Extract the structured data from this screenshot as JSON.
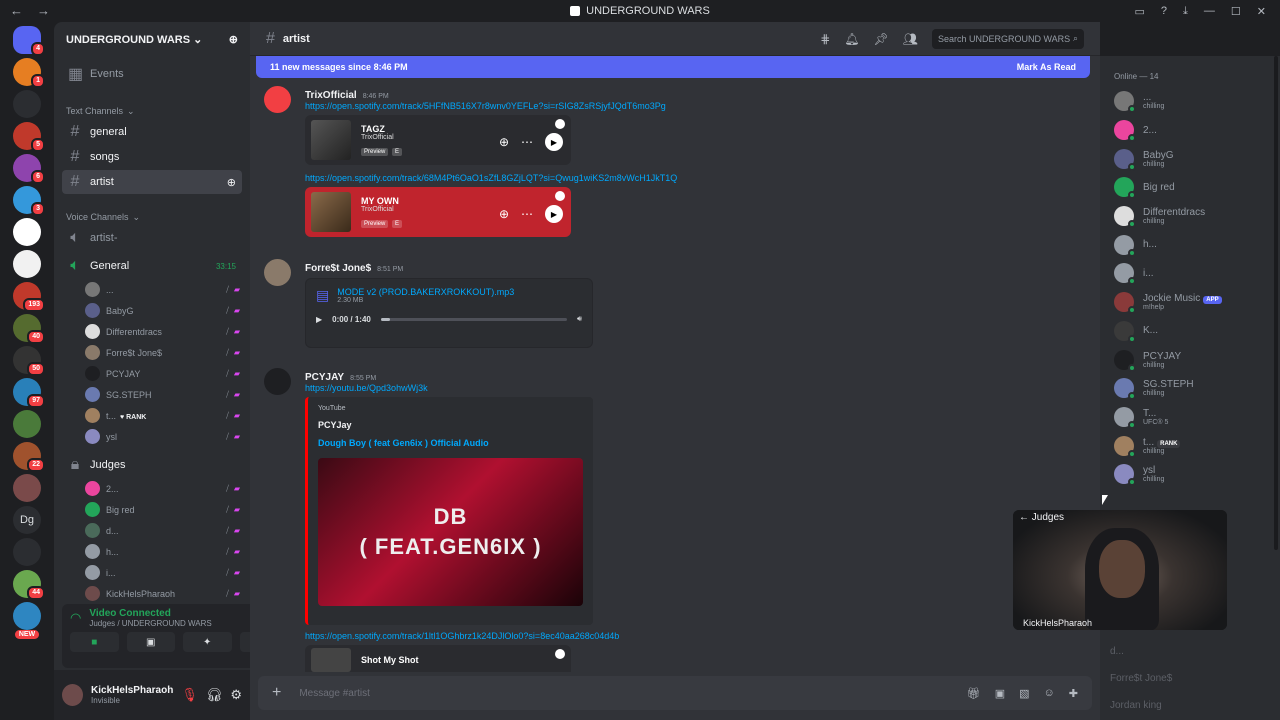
{
  "window": {
    "title": "UNDERGROUND WARS"
  },
  "servers": [
    {
      "color": "#5865f2",
      "badge": "4"
    },
    {
      "color": "#e67e22",
      "badge": "1"
    },
    {
      "color": "#2b2d31",
      "badge": ""
    },
    {
      "color": "#c0392b",
      "badge": "5"
    },
    {
      "color": "#8e44ad",
      "badge": "6"
    },
    {
      "color": "#3498db",
      "badge": "3"
    },
    {
      "color": "#ffffff",
      "badge": ""
    },
    {
      "color": "#f1f1f1",
      "badge": ""
    },
    {
      "color": "#c0392b",
      "badge": "193"
    },
    {
      "color": "#556b2f",
      "badge": "40"
    },
    {
      "color": "#333333",
      "badge": "50"
    },
    {
      "color": "#2980b9",
      "badge": "97"
    },
    {
      "color": "#4a7a3a",
      "badge": ""
    },
    {
      "color": "#a0522d",
      "badge": "22"
    },
    {
      "color": "#7a4a4a",
      "badge": ""
    },
    {
      "color": "#2b2d31",
      "badge": ""
    },
    {
      "color": "#6aa84f",
      "badge": "44"
    },
    {
      "color": "#2e86c1",
      "badge": ""
    }
  ],
  "server_dg_label": "Dg",
  "server_new_label": "NEW",
  "sidebar": {
    "server_name": "UNDERGROUND WARS",
    "events": "Events",
    "text_category": "Text Channels",
    "text_channels": [
      "general",
      "songs",
      "artist"
    ],
    "voice_category": "Voice Channels",
    "voice_channels": [
      {
        "name": "artist-",
        "time": ""
      },
      {
        "name": "General",
        "time": "33:15"
      }
    ],
    "general_users": [
      {
        "name": "...",
        "color": "#777"
      },
      {
        "name": "BabyG",
        "color": "#5a5f8a"
      },
      {
        "name": "Differentdracs",
        "color": "#ddd"
      },
      {
        "name": "Forre$t Jone$",
        "color": "#8a7a6a"
      },
      {
        "name": "PCYJAY",
        "color": "#1e1f22"
      },
      {
        "name": "SG.STEPH",
        "color": "#6a7ab0"
      },
      {
        "name": "t...",
        "color": "#a08060"
      },
      {
        "name": "ysl",
        "color": "#8a8ac0"
      }
    ],
    "rank_label": "RANK",
    "judges_channel": "Judges",
    "judges_users": [
      {
        "name": "2...",
        "color": "#eb459e"
      },
      {
        "name": "Big red",
        "color": "#23a55a"
      },
      {
        "name": "d...",
        "color": "#4a6a5a"
      },
      {
        "name": "h...",
        "color": "#949ba4"
      },
      {
        "name": "i...",
        "color": "#949ba4"
      },
      {
        "name": "KickHelsPharaoh",
        "color": "#6d4b4b"
      }
    ]
  },
  "voice_panel": {
    "title": "Video Connected",
    "subtitle": "Judges / UNDERGROUND WARS"
  },
  "user_panel": {
    "name": "KickHelsPharaoh",
    "status": "Invisible"
  },
  "channel": {
    "name": "artist",
    "search_placeholder": "Search UNDERGROUND WARS",
    "new_messages": "11 new messages since 8:46 PM",
    "mark_read": "Mark As Read",
    "composer_placeholder": "Message #artist"
  },
  "messages": {
    "m1": {
      "author": "TrixOfficial",
      "time": "8:46 PM",
      "link1": "https://open.spotify.com/track/5HFfNB516X7r8wnv0YEFLe?si=rSIG8ZsRSjyfJQdT6mo3Pg",
      "card1": {
        "title": "TAGZ",
        "artist": "TrixOfficial",
        "preview": "Preview",
        "explicit": "E"
      },
      "link2": "https://open.spotify.com/track/68M4Pt6OaO1sZfL8GZjLQT?si=Qwug1wiKS2m8vWcH1JkT1Q",
      "card2": {
        "title": "MY OWN",
        "artist": "TrixOfficial",
        "preview": "Preview",
        "explicit": "E"
      }
    },
    "m2": {
      "author": "Forre$t Jone$",
      "time": "8:51 PM",
      "file": "MODE v2 (PROD.BAKERXROKKOUT).mp3",
      "size": "2.30 MB",
      "progress": "0:00 / 1:40"
    },
    "m3": {
      "author": "PCYJAY",
      "time": "8:55 PM",
      "link": "https://youtu.be/Qpd3ohwWj3k",
      "provider": "YouTube",
      "channel": "PCYJay",
      "video_title": "Dough Boy ( feat Gen6ix ) Official Audio",
      "thumb_text": "DB\n( FEAT.GEN6IX )",
      "link2": "https://open.spotify.com/track/1ltl1OGhbrz1k24DJlOlo0?si=8ec40aa268c04d4b",
      "card3": {
        "title": "Shot My Shot"
      }
    }
  },
  "members": {
    "header": "Online — 14",
    "list": [
      {
        "name": "...",
        "status": "chilling",
        "color": "#777"
      },
      {
        "name": "2...",
        "status": "",
        "color": "#eb459e"
      },
      {
        "name": "BabyG",
        "status": "chilling",
        "color": "#5a5f8a"
      },
      {
        "name": "Big red",
        "status": "",
        "color": "#23a55a"
      },
      {
        "name": "Differentdracs",
        "status": "chilling",
        "color": "#ddd"
      },
      {
        "name": "h...",
        "status": "",
        "color": "#949ba4"
      },
      {
        "name": "i...",
        "status": "",
        "color": "#949ba4"
      },
      {
        "name": "Jockie Music",
        "status": "m!help",
        "color": "#8a3a3a",
        "tag": "APP"
      },
      {
        "name": "K...",
        "status": "",
        "color": "#3a3a3a"
      },
      {
        "name": "PCYJAY",
        "status": "chilling",
        "color": "#1e1f22"
      },
      {
        "name": "SG.STEPH",
        "status": "chilling",
        "color": "#6a7ab0"
      },
      {
        "name": "T...",
        "status": "UFC® 5",
        "color": "#949ba4"
      },
      {
        "name": "t...",
        "status": "chilling",
        "color": "#a08060",
        "tag": "RANK"
      },
      {
        "name": "ysl",
        "status": "chilling",
        "color": "#8a8ac0"
      }
    ],
    "offline": [
      "d...",
      "Forre$t Jone$",
      "Jordan king"
    ]
  },
  "popout": {
    "back": "Judges",
    "name": "KickHelsPharaoh"
  }
}
